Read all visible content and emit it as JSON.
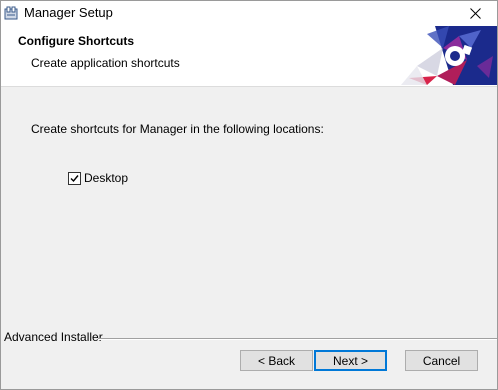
{
  "window": {
    "title": "Manager Setup"
  },
  "header": {
    "title": "Configure Shortcuts",
    "subtitle": "Create application shortcuts"
  },
  "body": {
    "instruction": "Create shortcuts for Manager in the following locations:",
    "options": [
      {
        "label": "Desktop",
        "checked": true
      }
    ]
  },
  "footer": {
    "brand": "Advanced Installer",
    "back_label": "< Back",
    "next_label": "Next >",
    "cancel_label": "Cancel"
  },
  "colors": {
    "accent": "#0078d7",
    "banner_dark": "#1b2a8c",
    "banner_red": "#d8234a",
    "banner_purple": "#8a2c9c"
  },
  "icons": {
    "app": "installer-package-icon",
    "close": "close-icon",
    "check": "check-icon"
  }
}
